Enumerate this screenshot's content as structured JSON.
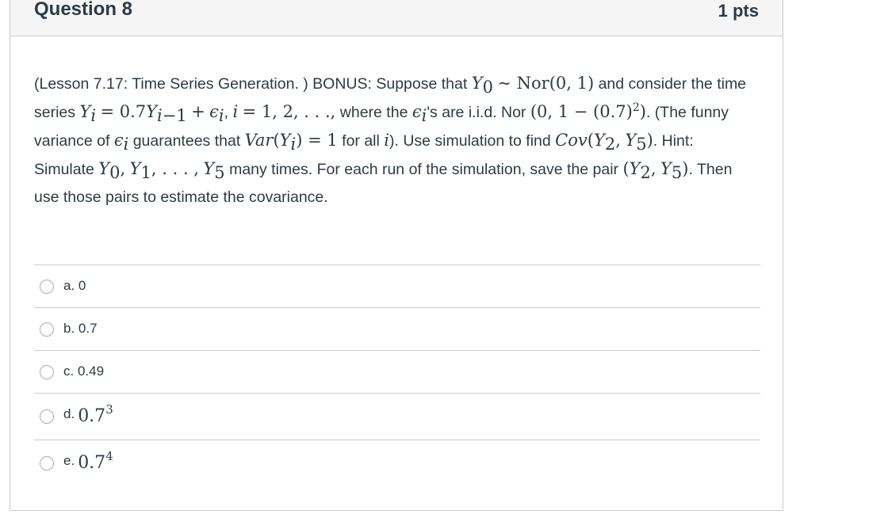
{
  "question": {
    "title": "Question 8",
    "points": "1 pts"
  },
  "answers": [
    {
      "prefix": "a.",
      "text": "0"
    },
    {
      "prefix": "b.",
      "text": "0.7"
    },
    {
      "prefix": "c.",
      "text": "0.49"
    },
    {
      "prefix": "d.",
      "base": "0.7",
      "exponent": "3"
    },
    {
      "prefix": "e.",
      "base": "0.7",
      "exponent": "4"
    }
  ]
}
